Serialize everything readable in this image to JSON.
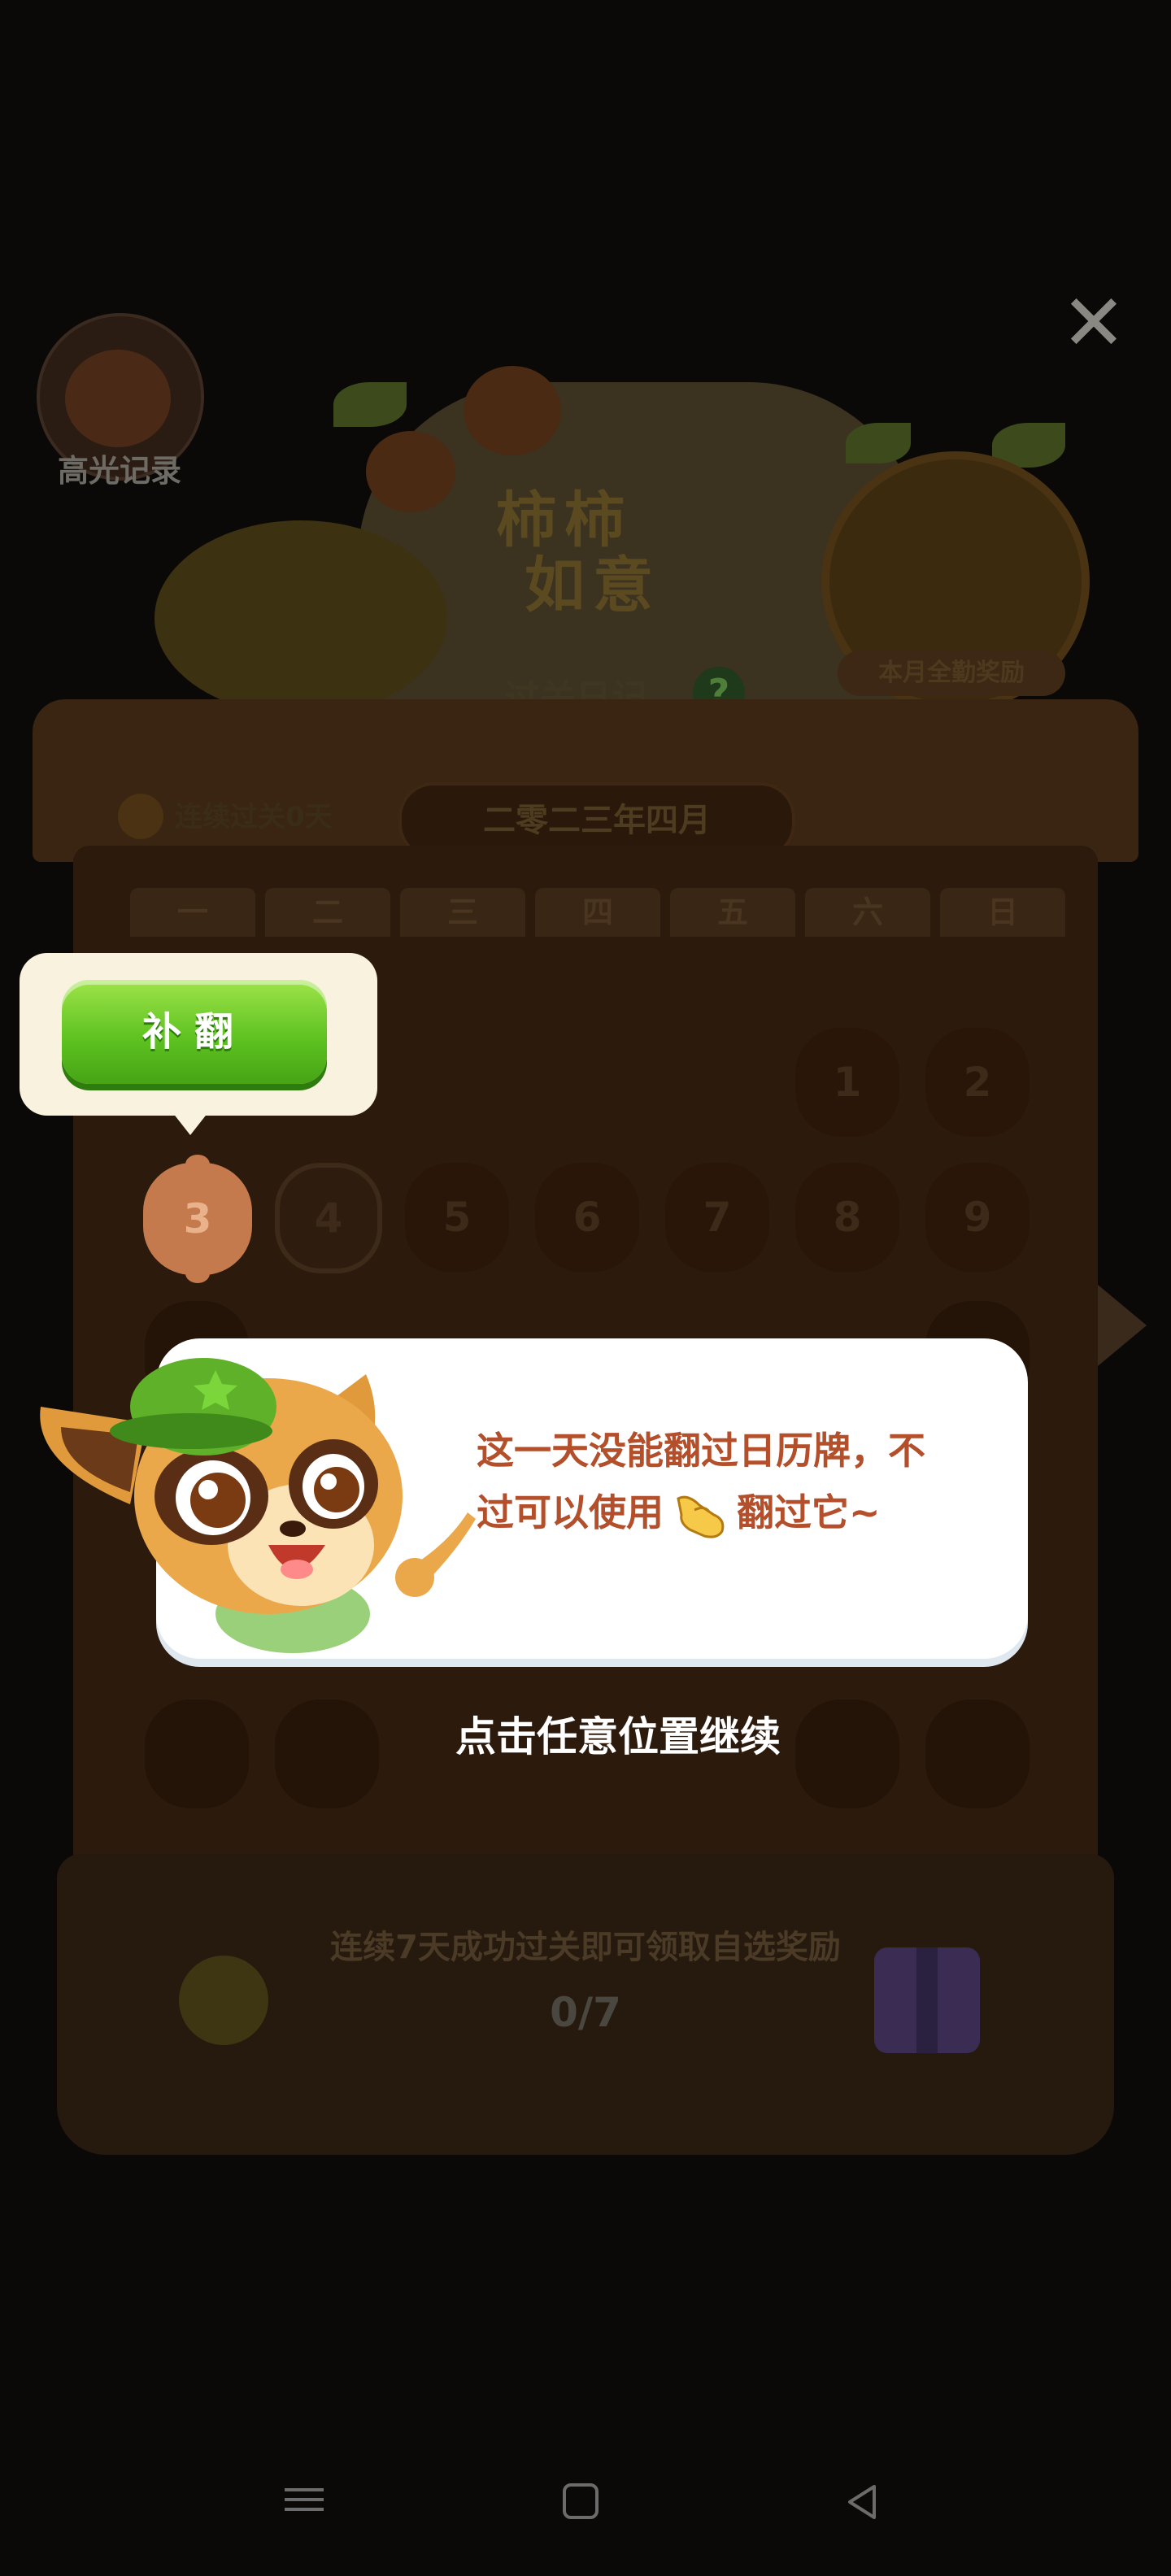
{
  "header": {
    "avatar_label": "高光记录",
    "close_icon": "close-icon"
  },
  "title": {
    "main_line1": "柿柿",
    "main_line2": "如意",
    "subtitle": "过关日记",
    "help_symbol": "?"
  },
  "monthly_reward": {
    "label": "本月全勤奖励"
  },
  "streak": {
    "text": "连续过关0天"
  },
  "calendar": {
    "month": "二零二三年四月",
    "weekdays": [
      "一",
      "二",
      "三",
      "四",
      "五",
      "六",
      "日"
    ],
    "row1": [
      "1",
      "2"
    ],
    "row2": [
      "3",
      "4",
      "5",
      "6",
      "7",
      "8",
      "9"
    ]
  },
  "tooltip": {
    "button_label": "补翻"
  },
  "speech_bubble": {
    "line1": "这一天没能翻过日历牌，不",
    "line2_prefix": "过可以使用",
    "line2_suffix": "翻过它~",
    "inline_icon": "pointing-hand-icon"
  },
  "continue_prompt": "点击任意位置继续",
  "reward_bar": {
    "text": "连续7天成功过关即可领取自选奖励",
    "progress": "0/7"
  },
  "colors": {
    "highlight_button": "#5fc321",
    "bubble_text": "#b34f2b",
    "overlay_bg": "#0b0907"
  }
}
